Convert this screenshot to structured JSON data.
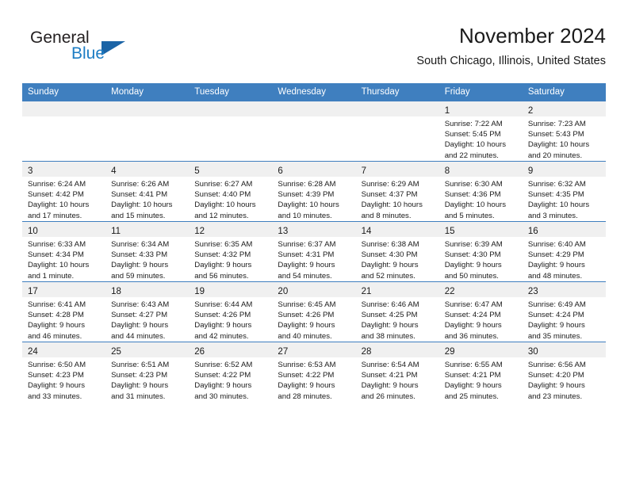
{
  "brand": {
    "name_part1": "General",
    "name_part2": "Blue",
    "triangle_color": "#1b64a6",
    "blue_color": "#1d7dc4"
  },
  "header": {
    "title": "November 2024",
    "subtitle": "South Chicago, Illinois, United States"
  },
  "theme": {
    "header_row_bg": "#3f7fbf",
    "daynum_band_bg": "#f0f0f0",
    "row_top_border": "#3f7fbf"
  },
  "weekday_headers": [
    "Sunday",
    "Monday",
    "Tuesday",
    "Wednesday",
    "Thursday",
    "Friday",
    "Saturday"
  ],
  "weeks": [
    [
      {
        "day": "",
        "lines": []
      },
      {
        "day": "",
        "lines": []
      },
      {
        "day": "",
        "lines": []
      },
      {
        "day": "",
        "lines": []
      },
      {
        "day": "",
        "lines": []
      },
      {
        "day": "1",
        "lines": [
          "Sunrise: 7:22 AM",
          "Sunset: 5:45 PM",
          "Daylight: 10 hours",
          "and 22 minutes."
        ]
      },
      {
        "day": "2",
        "lines": [
          "Sunrise: 7:23 AM",
          "Sunset: 5:43 PM",
          "Daylight: 10 hours",
          "and 20 minutes."
        ]
      }
    ],
    [
      {
        "day": "3",
        "lines": [
          "Sunrise: 6:24 AM",
          "Sunset: 4:42 PM",
          "Daylight: 10 hours",
          "and 17 minutes."
        ]
      },
      {
        "day": "4",
        "lines": [
          "Sunrise: 6:26 AM",
          "Sunset: 4:41 PM",
          "Daylight: 10 hours",
          "and 15 minutes."
        ]
      },
      {
        "day": "5",
        "lines": [
          "Sunrise: 6:27 AM",
          "Sunset: 4:40 PM",
          "Daylight: 10 hours",
          "and 12 minutes."
        ]
      },
      {
        "day": "6",
        "lines": [
          "Sunrise: 6:28 AM",
          "Sunset: 4:39 PM",
          "Daylight: 10 hours",
          "and 10 minutes."
        ]
      },
      {
        "day": "7",
        "lines": [
          "Sunrise: 6:29 AM",
          "Sunset: 4:37 PM",
          "Daylight: 10 hours",
          "and 8 minutes."
        ]
      },
      {
        "day": "8",
        "lines": [
          "Sunrise: 6:30 AM",
          "Sunset: 4:36 PM",
          "Daylight: 10 hours",
          "and 5 minutes."
        ]
      },
      {
        "day": "9",
        "lines": [
          "Sunrise: 6:32 AM",
          "Sunset: 4:35 PM",
          "Daylight: 10 hours",
          "and 3 minutes."
        ]
      }
    ],
    [
      {
        "day": "10",
        "lines": [
          "Sunrise: 6:33 AM",
          "Sunset: 4:34 PM",
          "Daylight: 10 hours",
          "and 1 minute."
        ]
      },
      {
        "day": "11",
        "lines": [
          "Sunrise: 6:34 AM",
          "Sunset: 4:33 PM",
          "Daylight: 9 hours",
          "and 59 minutes."
        ]
      },
      {
        "day": "12",
        "lines": [
          "Sunrise: 6:35 AM",
          "Sunset: 4:32 PM",
          "Daylight: 9 hours",
          "and 56 minutes."
        ]
      },
      {
        "day": "13",
        "lines": [
          "Sunrise: 6:37 AM",
          "Sunset: 4:31 PM",
          "Daylight: 9 hours",
          "and 54 minutes."
        ]
      },
      {
        "day": "14",
        "lines": [
          "Sunrise: 6:38 AM",
          "Sunset: 4:30 PM",
          "Daylight: 9 hours",
          "and 52 minutes."
        ]
      },
      {
        "day": "15",
        "lines": [
          "Sunrise: 6:39 AM",
          "Sunset: 4:30 PM",
          "Daylight: 9 hours",
          "and 50 minutes."
        ]
      },
      {
        "day": "16",
        "lines": [
          "Sunrise: 6:40 AM",
          "Sunset: 4:29 PM",
          "Daylight: 9 hours",
          "and 48 minutes."
        ]
      }
    ],
    [
      {
        "day": "17",
        "lines": [
          "Sunrise: 6:41 AM",
          "Sunset: 4:28 PM",
          "Daylight: 9 hours",
          "and 46 minutes."
        ]
      },
      {
        "day": "18",
        "lines": [
          "Sunrise: 6:43 AM",
          "Sunset: 4:27 PM",
          "Daylight: 9 hours",
          "and 44 minutes."
        ]
      },
      {
        "day": "19",
        "lines": [
          "Sunrise: 6:44 AM",
          "Sunset: 4:26 PM",
          "Daylight: 9 hours",
          "and 42 minutes."
        ]
      },
      {
        "day": "20",
        "lines": [
          "Sunrise: 6:45 AM",
          "Sunset: 4:26 PM",
          "Daylight: 9 hours",
          "and 40 minutes."
        ]
      },
      {
        "day": "21",
        "lines": [
          "Sunrise: 6:46 AM",
          "Sunset: 4:25 PM",
          "Daylight: 9 hours",
          "and 38 minutes."
        ]
      },
      {
        "day": "22",
        "lines": [
          "Sunrise: 6:47 AM",
          "Sunset: 4:24 PM",
          "Daylight: 9 hours",
          "and 36 minutes."
        ]
      },
      {
        "day": "23",
        "lines": [
          "Sunrise: 6:49 AM",
          "Sunset: 4:24 PM",
          "Daylight: 9 hours",
          "and 35 minutes."
        ]
      }
    ],
    [
      {
        "day": "24",
        "lines": [
          "Sunrise: 6:50 AM",
          "Sunset: 4:23 PM",
          "Daylight: 9 hours",
          "and 33 minutes."
        ]
      },
      {
        "day": "25",
        "lines": [
          "Sunrise: 6:51 AM",
          "Sunset: 4:23 PM",
          "Daylight: 9 hours",
          "and 31 minutes."
        ]
      },
      {
        "day": "26",
        "lines": [
          "Sunrise: 6:52 AM",
          "Sunset: 4:22 PM",
          "Daylight: 9 hours",
          "and 30 minutes."
        ]
      },
      {
        "day": "27",
        "lines": [
          "Sunrise: 6:53 AM",
          "Sunset: 4:22 PM",
          "Daylight: 9 hours",
          "and 28 minutes."
        ]
      },
      {
        "day": "28",
        "lines": [
          "Sunrise: 6:54 AM",
          "Sunset: 4:21 PM",
          "Daylight: 9 hours",
          "and 26 minutes."
        ]
      },
      {
        "day": "29",
        "lines": [
          "Sunrise: 6:55 AM",
          "Sunset: 4:21 PM",
          "Daylight: 9 hours",
          "and 25 minutes."
        ]
      },
      {
        "day": "30",
        "lines": [
          "Sunrise: 6:56 AM",
          "Sunset: 4:20 PM",
          "Daylight: 9 hours",
          "and 23 minutes."
        ]
      }
    ]
  ]
}
